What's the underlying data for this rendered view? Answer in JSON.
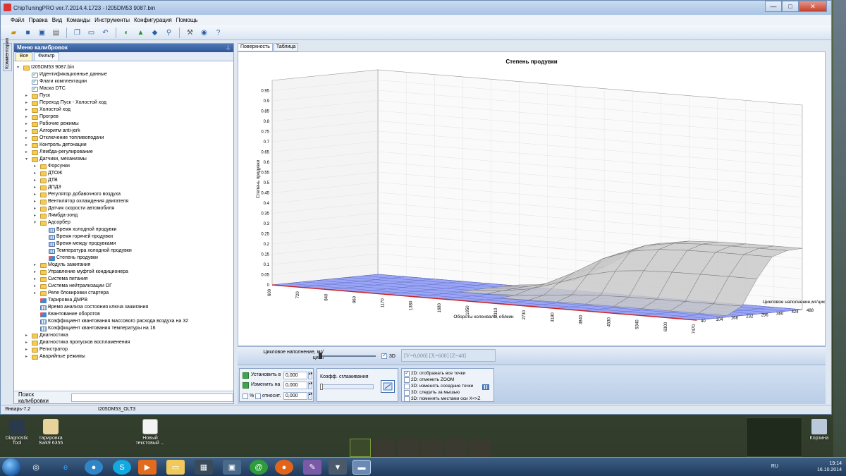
{
  "window": {
    "title": "ChipTuningPRO ver.7.2014.4.1723 - I205DM53 9087.bin",
    "controls": [
      "—",
      "□",
      "✕"
    ]
  },
  "menu": [
    "Файл",
    "Правка",
    "Вид",
    "Команды",
    "Инструменты",
    "Конфигурация",
    "Помощь"
  ],
  "left_strip_label": "Комментарии",
  "panel": {
    "title": "Меню калибровок",
    "pin": "⊥",
    "tabs": [
      "Все",
      "Фильтр"
    ],
    "search_label": "Поиск калибровки",
    "search_value": ""
  },
  "tree": [
    {
      "label": "I205DM53 9087.bin",
      "level": 0,
      "icon": "folder",
      "exp": "▾"
    },
    {
      "label": "Идентификационные данные",
      "level": 1,
      "icon": "check",
      "exp": ""
    },
    {
      "label": "Флаги комплектации",
      "level": 1,
      "icon": "check",
      "exp": ""
    },
    {
      "label": "Маска DTC",
      "level": 1,
      "icon": "check",
      "exp": ""
    },
    {
      "label": "Пуск",
      "level": 1,
      "icon": "folder",
      "exp": "▸"
    },
    {
      "label": "Переход Пуск - Холостой ход",
      "level": 1,
      "icon": "folder",
      "exp": "▸"
    },
    {
      "label": "Холостой ход",
      "level": 1,
      "icon": "folder",
      "exp": "▸"
    },
    {
      "label": "Прогрев",
      "level": 1,
      "icon": "folder",
      "exp": "▸"
    },
    {
      "label": "Рабочие режимы",
      "level": 1,
      "icon": "folder",
      "exp": "▸"
    },
    {
      "label": "Алгоритм anti-jerk",
      "level": 1,
      "icon": "folder",
      "exp": "▸"
    },
    {
      "label": "Отключение топливоподачи",
      "level": 1,
      "icon": "folder",
      "exp": "▸"
    },
    {
      "label": "Контроль детонации",
      "level": 1,
      "icon": "folder",
      "exp": "▸"
    },
    {
      "label": "Лямбда-регулирование",
      "level": 1,
      "icon": "folder",
      "exp": "▸"
    },
    {
      "label": "Датчики, механизмы",
      "level": 1,
      "icon": "folder",
      "exp": "▾"
    },
    {
      "label": "Форсунки",
      "level": 2,
      "icon": "folder",
      "exp": "▸"
    },
    {
      "label": "ДТОЖ",
      "level": 2,
      "icon": "folder",
      "exp": "▸"
    },
    {
      "label": "ДТВ",
      "level": 2,
      "icon": "folder",
      "exp": "▸"
    },
    {
      "label": "ДПДЗ",
      "level": 2,
      "icon": "folder",
      "exp": "▸"
    },
    {
      "label": "Регулятор добавочного воздуха",
      "level": 2,
      "icon": "folder",
      "exp": "▸"
    },
    {
      "label": "Вентилятор охлаждения двигателя",
      "level": 2,
      "icon": "folder",
      "exp": "▸"
    },
    {
      "label": "Датчик скорости автомобиля",
      "level": 2,
      "icon": "folder",
      "exp": "▸"
    },
    {
      "label": "Лямбда-зонд",
      "level": 2,
      "icon": "folder",
      "exp": "▸"
    },
    {
      "label": "Адсорбер",
      "level": 2,
      "icon": "folder",
      "exp": "▾"
    },
    {
      "label": "Время холодной продувки",
      "level": 3,
      "icon": "table",
      "exp": ""
    },
    {
      "label": "Время горячей продувки",
      "level": 3,
      "icon": "table",
      "exp": ""
    },
    {
      "label": "Время между продувками",
      "level": 3,
      "icon": "table",
      "exp": ""
    },
    {
      "label": "Температура холодной продувки",
      "level": 3,
      "icon": "table",
      "exp": ""
    },
    {
      "label": "Степень продувки",
      "level": 3,
      "icon": "surf",
      "exp": ""
    },
    {
      "label": "Модуль зажигания",
      "level": 2,
      "icon": "folder",
      "exp": "▸"
    },
    {
      "label": "Управление муфтой кондиционера",
      "level": 2,
      "icon": "folder",
      "exp": "▸"
    },
    {
      "label": "Система питания",
      "level": 2,
      "icon": "folder",
      "exp": "▸"
    },
    {
      "label": "Система нейтрализации ОГ",
      "level": 2,
      "icon": "folder",
      "exp": "▸"
    },
    {
      "label": "Реле блокировки стартера",
      "level": 2,
      "icon": "folder",
      "exp": "▸"
    },
    {
      "label": "Тарировка ДМРВ",
      "level": 2,
      "icon": "surf",
      "exp": ""
    },
    {
      "label": "Время анализа состояния ключа зажигания",
      "level": 2,
      "icon": "table",
      "exp": ""
    },
    {
      "label": "Квантование оборотов",
      "level": 2,
      "icon": "surf",
      "exp": ""
    },
    {
      "label": "Коэффициент квантования массового расхода воздуха на 32",
      "level": 2,
      "icon": "table",
      "exp": ""
    },
    {
      "label": "Коэффициент квантования температуры на 16",
      "level": 2,
      "icon": "table",
      "exp": ""
    },
    {
      "label": "Диагностика",
      "level": 1,
      "icon": "folder",
      "exp": "▸"
    },
    {
      "label": "Диагностика пропусков воспламенения",
      "level": 1,
      "icon": "folder",
      "exp": "▸"
    },
    {
      "label": "Регистратор",
      "level": 1,
      "icon": "folder",
      "exp": "▸"
    },
    {
      "label": "Аварийные режимы",
      "level": 1,
      "icon": "folder",
      "exp": "▸"
    }
  ],
  "view_tabs": [
    "Поверхность",
    "Таблица"
  ],
  "chart_data": {
    "type": "surface",
    "title": "Степень продувки",
    "xlabel": "Обороты коленвала, об/мин",
    "ylabel": "Цикловое наполнение,мг/цикл",
    "zlabel": "Степень продувки",
    "x_ticks": [
      "600",
      "720",
      "840",
      "960",
      "1170",
      "1380",
      "1680",
      "1950",
      "2310",
      "2730",
      "3180",
      "3840",
      "4530",
      "5340",
      "6300",
      "7470"
    ],
    "y_ticks": [
      "40",
      "104",
      "168",
      "232",
      "296",
      "360",
      "424",
      "488"
    ],
    "z_ticks": [
      "0",
      "0.05",
      "0.1",
      "0.15",
      "0.2",
      "0.25",
      "0.3",
      "0.35",
      "0.4",
      "0.45",
      "0.5",
      "0.55",
      "0.6",
      "0.65",
      "0.7",
      "0.75",
      "0.8",
      "0.85",
      "0.9",
      "0.95"
    ],
    "zlim": [
      0,
      1
    ],
    "note": "Surface is 0 for low/mid load; rises to ~0.3 for cycle filling above ~296 mg/cycle and RPM above ~2730",
    "high_load_plateau": 0.3,
    "colors": {
      "floor": "#9aa6f5",
      "surface": "#c9c9c9",
      "xaxis": "#cc2222"
    }
  },
  "controls": {
    "slider_label": "Цикловое наполнение, мг/цикл",
    "threeD_label": "3D",
    "threeD_checked": true,
    "readout": "[V=0,000] [X=600] [Z=40]",
    "set_label": "Установить в",
    "set_value": "0,000",
    "change_label": "Изменить на",
    "change_value": "0,000",
    "percent_label": "%",
    "relative_label": "относит.",
    "relative_value": "0,000",
    "smooth_label": "Коэфф. сглаживания",
    "options": [
      {
        "label": "2D: отображать все точки",
        "on": true
      },
      {
        "label": "2D: отменить ZOOM",
        "on": false
      },
      {
        "label": "3D: изменять соседние точки",
        "on": false
      },
      {
        "label": "3D: следить за мышью",
        "on": false
      },
      {
        "label": "3D: поменять местами оси X<>Z",
        "on": false
      }
    ]
  },
  "status": {
    "left": "Январь-7.2",
    "right": "I205DM53_OLT3"
  },
  "desktop_icons": [
    {
      "label": "Diagnostic Tool"
    },
    {
      "label": "тарировка Swk9 6355"
    },
    {
      "label": "Новый текстовый ..."
    },
    {
      "label": "Корзина"
    }
  ],
  "tray": {
    "lang": "RU",
    "time": "19:14",
    "date": "16.10.2014"
  }
}
